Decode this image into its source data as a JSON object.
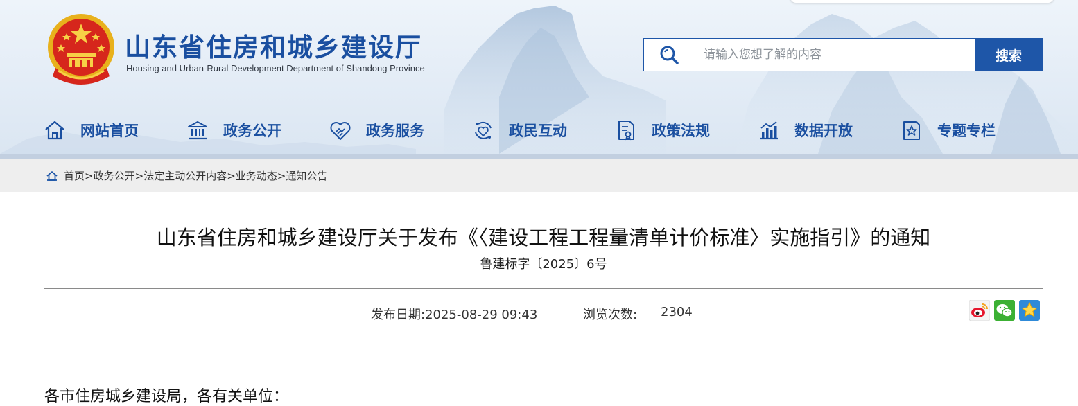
{
  "header": {
    "title_cn": "山东省住房和城乡建设厅",
    "title_en": "Housing and Urban-Rural Development Department of Shandong Province",
    "emblem_icon": "national-emblem-icon"
  },
  "search": {
    "placeholder": "请输入您想了解的内容",
    "button_label": "搜索"
  },
  "nav": {
    "items": [
      {
        "label": "网站首页",
        "icon": "home-icon"
      },
      {
        "label": "政务公开",
        "icon": "government-building-icon"
      },
      {
        "label": "政务服务",
        "icon": "handshake-icon"
      },
      {
        "label": "政民互动",
        "icon": "interaction-icon"
      },
      {
        "label": "政策法规",
        "icon": "document-icon"
      },
      {
        "label": "数据开放",
        "icon": "bar-chart-icon"
      },
      {
        "label": "专题专栏",
        "icon": "star-folder-icon"
      }
    ]
  },
  "breadcrumb": {
    "items": [
      "首页",
      "政务公开",
      "法定主动公开内容",
      "业务动态",
      "通知公告"
    ],
    "separator": ">"
  },
  "article": {
    "title": "山东省住房和城乡建设厅关于发布《〈建设工程工程量清单计价标准〉实施指引》的通知",
    "doc_number": "鲁建标字〔2025〕6号",
    "publish_label": "发布日期:",
    "publish_date": "2025-08-29 09:43",
    "views_label": "浏览次数:",
    "views_count": "2304",
    "salutation": "各市住房城乡建设局，各有关单位："
  },
  "share": {
    "icons": [
      "weibo-icon",
      "wechat-icon",
      "favorite-star-icon"
    ]
  },
  "colors": {
    "brand_blue": "#1a4fa0",
    "button_blue": "#1e56a8",
    "breadcrumb_bg": "#eeeeee"
  }
}
